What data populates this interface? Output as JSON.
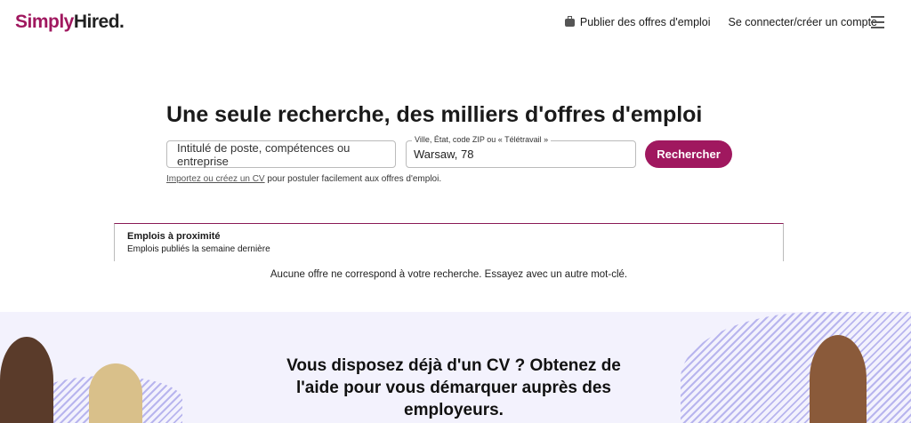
{
  "header": {
    "logo_part1": "Simply",
    "logo_part2": "Hired.",
    "post_jobs": "Publier des offres d'emploi",
    "sign_in": "Se connecter/créer un compte"
  },
  "search": {
    "title": "Une seule recherche, des milliers d'offres d'emploi",
    "what_placeholder": "Intitulé de poste, compétences ou entreprise",
    "where_label": "Ville, État, code ZIP ou « Télétravail »",
    "where_value": "Warsaw, 78",
    "button": "Rechercher",
    "hint_link": "Importez ou créez un CV",
    "hint_text": " pour postuler facilement aux offres d'emploi."
  },
  "nearby": {
    "title": "Emplois à proximité",
    "subtitle": "Emplois publiés la semaine dernière",
    "empty": "Aucune offre ne correspond à votre recherche. Essayez avec un autre mot-clé."
  },
  "banner": {
    "text": "Vous disposez déjà d'un CV ? Obtenez de l'aide pour vous démarquer auprès des employeurs."
  },
  "colors": {
    "brand": "#a0185f",
    "banner_bg": "#f3f2fd"
  }
}
